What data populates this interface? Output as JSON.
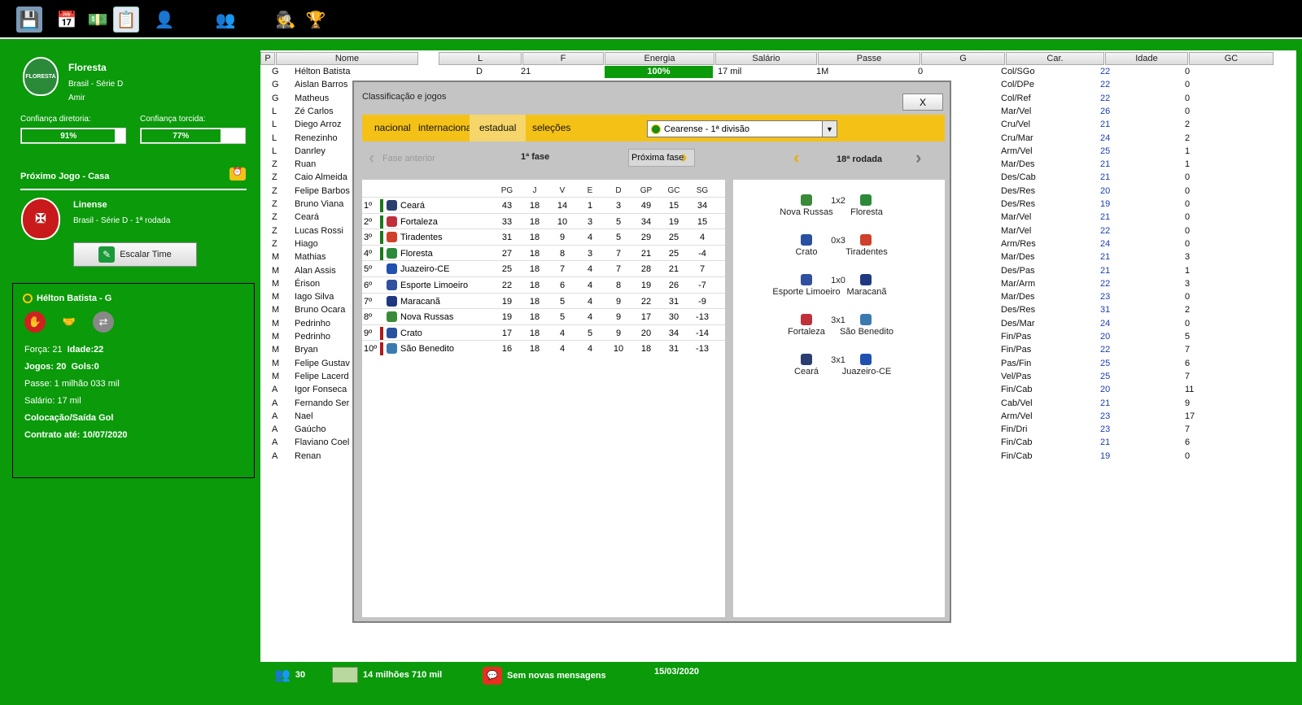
{
  "toolbar": {
    "icons": [
      "save-icon",
      "calendar-icon",
      "money-icon",
      "document-icon",
      "manager-icon",
      "stadium-icon",
      "staff-icon",
      "transfer-icon",
      "scout-icon",
      "awards-icon"
    ]
  },
  "club": {
    "name": "Floresta",
    "crest_text": "FLORESTA",
    "league": "Brasil - Série D",
    "manager": "Amir",
    "confidence_board_label": "Confiança diretoria:",
    "confidence_board": "91%",
    "confidence_board_value": 91,
    "confidence_fans_label": "Confiança torcida:",
    "confidence_fans": "77%",
    "confidence_fans_value": 77
  },
  "next_match": {
    "title": "Próximo Jogo - Casa",
    "opponent": "Linense",
    "details": "Brasil - Série D - 1ª rodada",
    "button": "Escalar Time"
  },
  "player": {
    "header": "Hélton Batista - G",
    "forca": "Força: 21",
    "idade": "Idade:22",
    "jogos": "Jogos: 20",
    "gols": "Gols:0",
    "passe": "Passe: 1 milhão 033 mil",
    "salario": "Salário: 17 mil",
    "position": "Colocação/Saída Gol",
    "contract": "Contrato até: 10/07/2020"
  },
  "squad_table": {
    "columns": [
      "P",
      "Nome",
      "L",
      "F",
      "Energia",
      "Salário",
      "Passe",
      "G",
      "Car.",
      "Idade",
      "GC"
    ],
    "first_row": {
      "l": "D",
      "f": "21",
      "energia": "100%",
      "salario": "17 mil",
      "passe": "1M",
      "g": "0"
    },
    "rows": [
      {
        "p": "G",
        "nome": "Hélton Batista",
        "car": "Col/SGo",
        "idade": "22",
        "gc": "0"
      },
      {
        "p": "G",
        "nome": "Aislan Barros",
        "car": "Col/DPe",
        "idade": "22",
        "gc": "0"
      },
      {
        "p": "G",
        "nome": "Matheus",
        "car": "Col/Ref",
        "idade": "22",
        "gc": "0"
      },
      {
        "p": "L",
        "nome": "Zé Carlos",
        "car": "Mar/Vel",
        "idade": "26",
        "gc": "0"
      },
      {
        "p": "L",
        "nome": "Diego Arroz",
        "car": "Cru/Vel",
        "idade": "21",
        "gc": "2"
      },
      {
        "p": "L",
        "nome": "Renezinho",
        "car": "Cru/Mar",
        "idade": "24",
        "gc": "2"
      },
      {
        "p": "L",
        "nome": "Danrley",
        "car": "Arm/Vel",
        "idade": "25",
        "gc": "1"
      },
      {
        "p": "Z",
        "nome": "Ruan",
        "car": "Mar/Des",
        "idade": "21",
        "gc": "1"
      },
      {
        "p": "Z",
        "nome": "Caio Almeida",
        "car": "Des/Cab",
        "idade": "21",
        "gc": "0"
      },
      {
        "p": "Z",
        "nome": "Felipe Barbos",
        "car": "Des/Res",
        "idade": "20",
        "gc": "0"
      },
      {
        "p": "Z",
        "nome": "Bruno Viana",
        "car": "Des/Res",
        "idade": "19",
        "gc": "0"
      },
      {
        "p": "Z",
        "nome": "Ceará",
        "car": "Mar/Vel",
        "idade": "21",
        "gc": "0"
      },
      {
        "p": "Z",
        "nome": "Lucas Rossi",
        "car": "Mar/Vel",
        "idade": "22",
        "gc": "0"
      },
      {
        "p": "Z",
        "nome": "Hiago",
        "car": "Arm/Res",
        "idade": "24",
        "gc": "0"
      },
      {
        "p": "M",
        "nome": "Mathias",
        "car": "Mar/Des",
        "idade": "21",
        "gc": "3"
      },
      {
        "p": "M",
        "nome": "Alan Assis",
        "car": "Des/Pas",
        "idade": "21",
        "gc": "1"
      },
      {
        "p": "M",
        "nome": "Érison",
        "car": "Mar/Arm",
        "idade": "22",
        "gc": "3"
      },
      {
        "p": "M",
        "nome": "Iago Silva",
        "car": "Mar/Des",
        "idade": "23",
        "gc": "0"
      },
      {
        "p": "M",
        "nome": "Bruno Ocara",
        "car": "Des/Res",
        "idade": "31",
        "gc": "2"
      },
      {
        "p": "M",
        "nome": "Pedrinho",
        "car": "Des/Mar",
        "idade": "24",
        "gc": "0"
      },
      {
        "p": "M",
        "nome": "Pedrinho",
        "car": "Fin/Pas",
        "idade": "20",
        "gc": "5"
      },
      {
        "p": "M",
        "nome": "Bryan",
        "car": "Fin/Pas",
        "idade": "22",
        "gc": "7"
      },
      {
        "p": "M",
        "nome": "Felipe Gustav",
        "car": "Pas/Fin",
        "idade": "25",
        "gc": "6"
      },
      {
        "p": "M",
        "nome": "Felipe Lacerd",
        "car": "Vel/Pas",
        "idade": "25",
        "gc": "7"
      },
      {
        "p": "A",
        "nome": "Igor Fonseca",
        "car": "Fin/Cab",
        "idade": "20",
        "gc": "11"
      },
      {
        "p": "A",
        "nome": "Fernando Ser",
        "car": "Cab/Vel",
        "idade": "21",
        "gc": "9"
      },
      {
        "p": "A",
        "nome": "Nael",
        "car": "Arm/Vel",
        "idade": "23",
        "gc": "17"
      },
      {
        "p": "A",
        "nome": "Gaúcho",
        "car": "Fin/Dri",
        "idade": "23",
        "gc": "7"
      },
      {
        "p": "A",
        "nome": "Flaviano Coel",
        "car": "Fin/Cab",
        "idade": "21",
        "gc": "6"
      },
      {
        "p": "A",
        "nome": "Renan",
        "car": "Fin/Cab",
        "idade": "19",
        "gc": "0"
      }
    ]
  },
  "modal": {
    "title": "Classificação e jogos",
    "close": "X",
    "tabs": [
      "nacional",
      "internacional",
      "estadual",
      "seleções"
    ],
    "active_tab": "estadual",
    "competition": "Cearense - 1ª divisão",
    "prev_phase": "Fase anterior",
    "phase": "1ª fase",
    "next_phase": "Próxima fase",
    "round": "18ª rodada",
    "standings_columns": [
      "PG",
      "J",
      "V",
      "E",
      "D",
      "GP",
      "GC",
      "SG"
    ],
    "standings": [
      {
        "pos": "1º",
        "team": "Ceará",
        "mark": "#1a7a1a",
        "badge": "#2c3e70",
        "pg": "43",
        "j": "18",
        "v": "14",
        "e": "1",
        "d": "3",
        "gp": "49",
        "gc": "15",
        "sg": "34"
      },
      {
        "pos": "2º",
        "team": "Fortaleza",
        "mark": "#1a7a1a",
        "badge": "#c0303a",
        "pg": "33",
        "j": "18",
        "v": "10",
        "e": "3",
        "d": "5",
        "gp": "34",
        "gc": "19",
        "sg": "15"
      },
      {
        "pos": "3º",
        "team": "Tiradentes",
        "mark": "#1a7a1a",
        "badge": "#d0402a",
        "pg": "31",
        "j": "18",
        "v": "9",
        "e": "4",
        "d": "5",
        "gp": "29",
        "gc": "25",
        "sg": "4"
      },
      {
        "pos": "4º",
        "team": "Floresta",
        "mark": "#1a7a1a",
        "badge": "#2a8a3a",
        "pg": "27",
        "j": "18",
        "v": "8",
        "e": "3",
        "d": "7",
        "gp": "21",
        "gc": "25",
        "sg": "-4"
      },
      {
        "pos": "5º",
        "team": "Juazeiro-CE",
        "mark": "",
        "badge": "#2050b0",
        "pg": "25",
        "j": "18",
        "v": "7",
        "e": "4",
        "d": "7",
        "gp": "28",
        "gc": "21",
        "sg": "7"
      },
      {
        "pos": "6º",
        "team": "Esporte Limoeiro",
        "mark": "",
        "badge": "#3050a0",
        "pg": "22",
        "j": "18",
        "v": "6",
        "e": "4",
        "d": "8",
        "gp": "19",
        "gc": "26",
        "sg": "-7"
      },
      {
        "pos": "7º",
        "team": "Maracanã",
        "mark": "",
        "badge": "#203880",
        "pg": "19",
        "j": "18",
        "v": "5",
        "e": "4",
        "d": "9",
        "gp": "22",
        "gc": "31",
        "sg": "-9"
      },
      {
        "pos": "8º",
        "team": "Nova Russas",
        "mark": "",
        "badge": "#3a8a3a",
        "pg": "19",
        "j": "18",
        "v": "5",
        "e": "4",
        "d": "9",
        "gp": "17",
        "gc": "30",
        "sg": "-13"
      },
      {
        "pos": "9º",
        "team": "Crato",
        "mark": "#b01a1a",
        "badge": "#2a50a0",
        "pg": "17",
        "j": "18",
        "v": "4",
        "e": "5",
        "d": "9",
        "gp": "20",
        "gc": "34",
        "sg": "-14"
      },
      {
        "pos": "10º",
        "team": "São Benedito",
        "mark": "#b01a1a",
        "badge": "#3a7ab0",
        "pg": "16",
        "j": "18",
        "v": "4",
        "e": "4",
        "d": "10",
        "gp": "18",
        "gc": "31",
        "sg": "-13"
      }
    ],
    "games": [
      {
        "home": "Nova Russas",
        "home_badge": "#3a8a3a",
        "score": "1x2",
        "away": "Floresta",
        "away_badge": "#2a8a3a"
      },
      {
        "home": "Crato",
        "home_badge": "#2a50a0",
        "score": "0x3",
        "away": "Tiradentes",
        "away_badge": "#d0402a"
      },
      {
        "home": "Esporte Limoeiro",
        "home_badge": "#3050a0",
        "score": "1x0",
        "away": "Maracanã",
        "away_badge": "#203880"
      },
      {
        "home": "Fortaleza",
        "home_badge": "#c0303a",
        "score": "3x1",
        "away": "São Benedito",
        "away_badge": "#3a7ab0"
      },
      {
        "home": "Ceará",
        "home_badge": "#2c3e70",
        "score": "3x1",
        "away": "Juazeiro-CE",
        "away_badge": "#2050b0"
      }
    ]
  },
  "status": {
    "squad_count": "30",
    "money": "14 milhões 710 mil",
    "messages": "Sem novas mensagens",
    "date": "15/03/2020"
  },
  "colors": {
    "background": "#0a9a0a",
    "accent_yellow": "#f4c117",
    "energy_green": "#0a9a0a"
  }
}
